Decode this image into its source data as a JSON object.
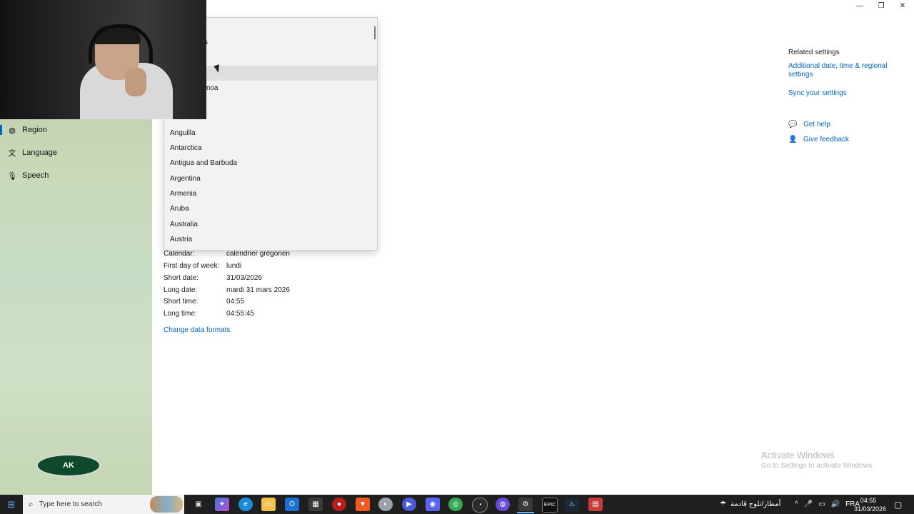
{
  "window": {
    "minimize_label": "—",
    "maximize_label": "❐",
    "close_label": "✕"
  },
  "sidebar": {
    "items": [
      {
        "label": "Region",
        "icon": "globe-icon",
        "active": true
      },
      {
        "label": "Language",
        "icon": "language-icon",
        "active": false
      },
      {
        "label": "Speech",
        "icon": "microphone-icon",
        "active": false
      }
    ]
  },
  "logo": {
    "text": "AK"
  },
  "dropdown": {
    "partial_items": [
      "s",
      "moa"
    ],
    "items": [
      "Anguilla",
      "Antarctica",
      "Antigua and Barbuda",
      "Argentina",
      "Armenia",
      "Aruba",
      "Australia",
      "Austria"
    ]
  },
  "formats": {
    "rows": [
      {
        "label": "Calendar:",
        "value": "calendrier grégorien"
      },
      {
        "label": "First day of week:",
        "value": "lundi"
      },
      {
        "label": "Short date:",
        "value": "31/03/2026"
      },
      {
        "label": "Long date:",
        "value": "mardi 31 mars 2026"
      },
      {
        "label": "Short time:",
        "value": "04:55"
      },
      {
        "label": "Long time:",
        "value": "04:55:45"
      }
    ],
    "change_link": "Change data formats"
  },
  "related": {
    "title": "Related settings",
    "additional_line1": "Additional date, time & regional",
    "additional_line2": "settings",
    "sync": "Sync your settings",
    "get_help": "Get help",
    "give_feedback": "Give feedback"
  },
  "watermark": {
    "line1": "Activate Windows",
    "line2": "Go to Settings to activate Windows."
  },
  "taskbar": {
    "search_placeholder": "Type here to search",
    "weather_text": "أمطار/ثلوج قادمة",
    "language": "FRA",
    "time": "04:55",
    "date": "31/03/2026",
    "accent_color": "#6ab0ff",
    "apps": [
      "task-view-icon",
      "copilot-icon",
      "edge-icon",
      "file-explorer-icon",
      "outlook-icon",
      "store-icon",
      "app-red-icon",
      "brave-icon",
      "app-grey-icon",
      "app-purple-icon",
      "discord-icon",
      "chrome-icon",
      "obs-icon",
      "app-chat-icon",
      "settings-icon",
      "epic-games-icon",
      "steam-icon",
      "app-red2-icon"
    ]
  }
}
